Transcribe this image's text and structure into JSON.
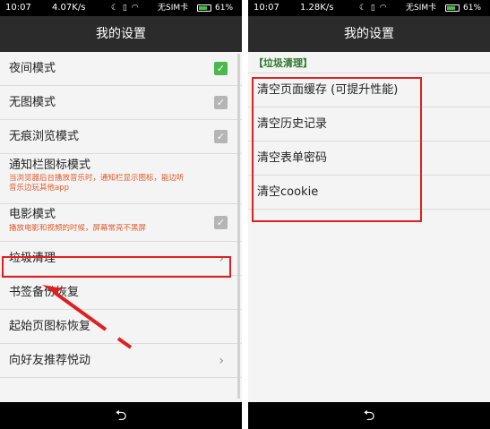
{
  "left": {
    "status": {
      "time": "10:07",
      "speed": "4.07K/s",
      "icons": "☾ ▯ ◠",
      "sim": "无SIM卡",
      "battery": "61%"
    },
    "title": "我的设置",
    "items": [
      {
        "label": "夜间模式",
        "checked": true
      },
      {
        "label": "无图模式",
        "checked": false
      },
      {
        "label": "无痕浏览模式",
        "checked": false
      },
      {
        "label": "通知栏图标模式",
        "desc": "当浏览器后台播放音乐时，通知栏显示图标，能边听音乐边玩其他app"
      },
      {
        "label": "电影模式",
        "desc": "播放电影和视频的时候，屏幕常亮不黑屏",
        "checked": false
      },
      {
        "label": "垃圾清理",
        "chevron": "›"
      },
      {
        "label": "书签备份恢复"
      },
      {
        "label": "起始页图标恢复"
      },
      {
        "label": "向好友推荐悦动",
        "chevron": "›"
      }
    ],
    "nav_back": "⮌"
  },
  "right": {
    "status": {
      "time": "10:07",
      "speed": "1.28K/s",
      "icons": "☾ ▯ ◠",
      "sim": "无SIM卡",
      "battery": "61%"
    },
    "title": "我的设置",
    "section": "【垃圾清理】",
    "items": [
      {
        "label": "清空页面缓存 (可提升性能)"
      },
      {
        "label": "清空历史记录"
      },
      {
        "label": "清空表单密码"
      },
      {
        "label": "清空cookie"
      }
    ],
    "nav_back": "⮌"
  },
  "icons": {
    "check": "✓",
    "chevron": "chevron-right-icon",
    "back": "back-icon"
  },
  "colors": {
    "titlebar": "#2b2b2b",
    "checkbox_on": "#4ab84a",
    "checkbox_off": "#b5b5b5",
    "section_header": "#2a7a2a",
    "description": "#e05a2b",
    "annotation_red": "#e02020"
  }
}
